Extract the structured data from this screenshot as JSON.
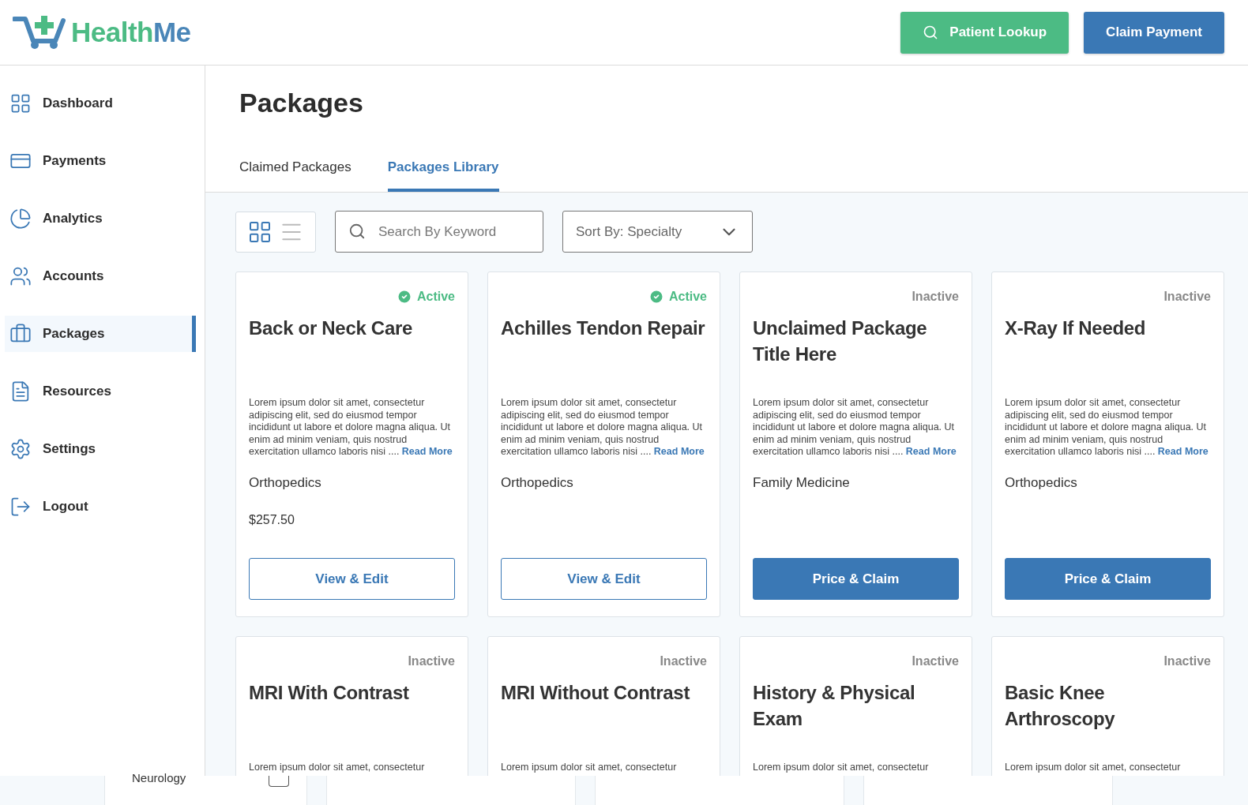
{
  "header": {
    "logo": {
      "part_1": "Health",
      "part_2": "Me"
    },
    "buttons": [
      {
        "kind": "lookup",
        "label": "Patient Lookup"
      },
      {
        "kind": "primary",
        "label": "Claim Payment"
      }
    ]
  },
  "sidebar": {
    "items": [
      {
        "kind": "dashboard",
        "label": "Dashboard",
        "selected": false
      },
      {
        "kind": "payments",
        "label": "Payments",
        "selected": false
      },
      {
        "kind": "analytics",
        "label": "Analytics",
        "selected": false
      },
      {
        "kind": "accounts",
        "label": "Accounts",
        "selected": false
      },
      {
        "kind": "packages",
        "label": "Packages",
        "selected": true
      },
      {
        "kind": "resources",
        "label": "Resources",
        "selected": false
      },
      {
        "kind": "settings",
        "label": "Settings",
        "selected": false
      },
      {
        "kind": "logout",
        "label": "Logout",
        "selected": false
      }
    ]
  },
  "page_title": "Packages",
  "tabs": [
    {
      "label": "Claimed Packages",
      "selected": false
    },
    {
      "label": "Packages Library",
      "selected": true
    }
  ],
  "toolbar": {
    "view_modes": [
      {
        "kind": "grid",
        "selected": true
      },
      {
        "kind": "list",
        "selected": false
      }
    ],
    "search": {
      "placeholder": "Search By Keyword"
    },
    "sort": {
      "value": "Sort By: Specialty"
    }
  },
  "cards": [
    {
      "active": true,
      "status": "Active",
      "title": "Back or Neck Care",
      "description": "Lorem ipsum dolor sit amet, consectetur adipiscing elit, sed do eiusmod tempor incididunt ut labore et dolore magna aliqua. Ut enim ad minim veniam, quis nostrud exercitation ullamco laboris nisi  ....",
      "link": "Read More",
      "specialty": "Orthopedics",
      "price": "$257.50",
      "button": {
        "kind": "outline",
        "label": "View & Edit"
      }
    },
    {
      "active": true,
      "status": "Active",
      "title": "Achilles Tendon Repair",
      "description": "Lorem ipsum dolor sit amet, consectetur adipiscing elit, sed do eiusmod tempor incididunt ut labore et dolore magna aliqua. Ut enim ad minim veniam, quis nostrud exercitation ullamco laboris nisi  ....",
      "link": "Read More",
      "specialty": "Orthopedics",
      "button": {
        "kind": "outline",
        "label": "View & Edit"
      }
    },
    {
      "active": false,
      "status": "Inactive",
      "title": "Unclaimed Package Title Here",
      "description": "Lorem ipsum dolor sit amet, consectetur adipiscing elit, sed do eiusmod tempor incididunt ut labore et dolore magna aliqua. Ut enim ad minim veniam, quis nostrud exercitation ullamco laboris nisi  ....",
      "link": "Read More",
      "specialty": "Family Medicine",
      "button": {
        "kind": "primary",
        "label": "Price & Claim"
      }
    },
    {
      "active": false,
      "status": "Inactive",
      "title": "X-Ray If Needed",
      "description": "Lorem ipsum dolor sit amet, consectetur adipiscing elit, sed do eiusmod tempor incididunt ut labore et dolore magna aliqua. Ut enim ad minim veniam, quis nostrud exercitation ullamco laboris nisi  ....",
      "link": "Read More",
      "specialty": "Orthopedics",
      "button": {
        "kind": "primary",
        "label": "Price & Claim"
      }
    },
    {
      "active": false,
      "status": "Inactive",
      "title": "MRI With Contrast",
      "description": "Lorem ipsum dolor sit amet, consectetur"
    },
    {
      "active": false,
      "status": "Inactive",
      "title": "MRI Without Contrast",
      "description": "Lorem ipsum dolor sit amet, consectetur"
    },
    {
      "active": false,
      "status": "Inactive",
      "title": "History & Physical Exam",
      "description": "Lorem ipsum dolor sit amet, consectetur"
    },
    {
      "active": false,
      "status": "Inactive",
      "title": "Basic Knee Arthroscopy",
      "description": "Lorem ipsum dolor sit amet, consectetur"
    }
  ],
  "bottom_strip": {
    "text": "Neurology"
  }
}
